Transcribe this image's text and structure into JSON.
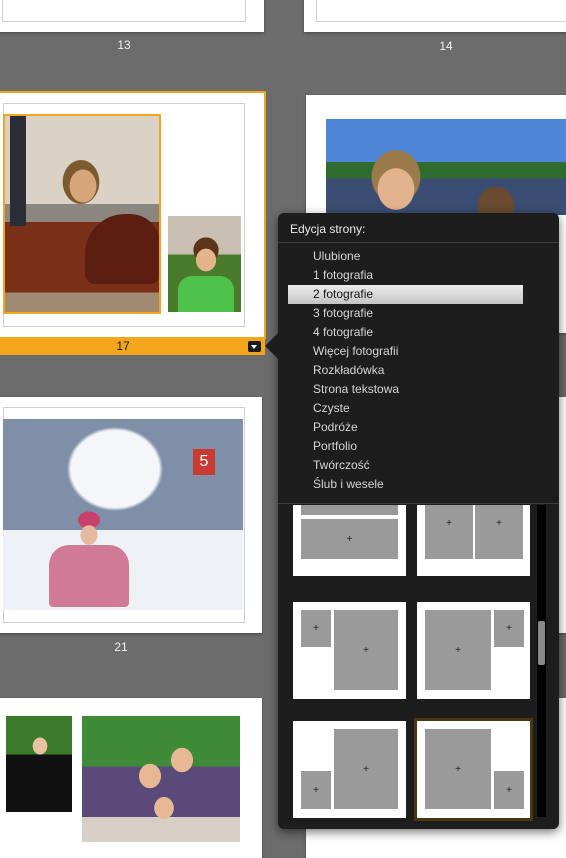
{
  "spreads": {
    "page_13": "13",
    "page_14": "14",
    "page_17": "17",
    "page_21": "21"
  },
  "popup": {
    "title": "Edycja strony:",
    "items": [
      {
        "label": "Ulubione",
        "active": false
      },
      {
        "label": "1 fotografia",
        "active": false
      },
      {
        "label": "2 fotografie",
        "active": true
      },
      {
        "label": "3 fotografie",
        "active": false
      },
      {
        "label": "4 fotografie",
        "active": false
      },
      {
        "label": "Więcej fotografii",
        "active": false
      },
      {
        "label": "Rozkładówka",
        "active": false
      },
      {
        "label": "Strona tekstowa",
        "active": false
      },
      {
        "label": "Czyste",
        "active": false
      },
      {
        "label": "Podróże",
        "active": false
      },
      {
        "label": "Portfolio",
        "active": false
      },
      {
        "label": "Twórczość",
        "active": false
      },
      {
        "label": "Ślub i wesele",
        "active": false
      }
    ],
    "layout_plus": "+"
  },
  "colors": {
    "selection": "#f3a61b",
    "background": "#6c6c6c",
    "popup_bg": "#1d1d1d"
  }
}
